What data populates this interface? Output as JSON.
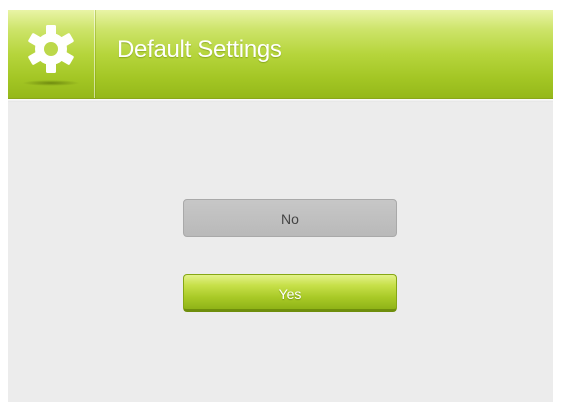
{
  "header": {
    "title": "Default Settings",
    "icon": "gear-icon"
  },
  "dialog": {
    "no_label": "No",
    "yes_label": "Yes"
  },
  "colors": {
    "header_accent": "#b6d53c",
    "yes_button": "#a9ca27",
    "no_button": "#bfbfbf",
    "background": "#ececec"
  }
}
